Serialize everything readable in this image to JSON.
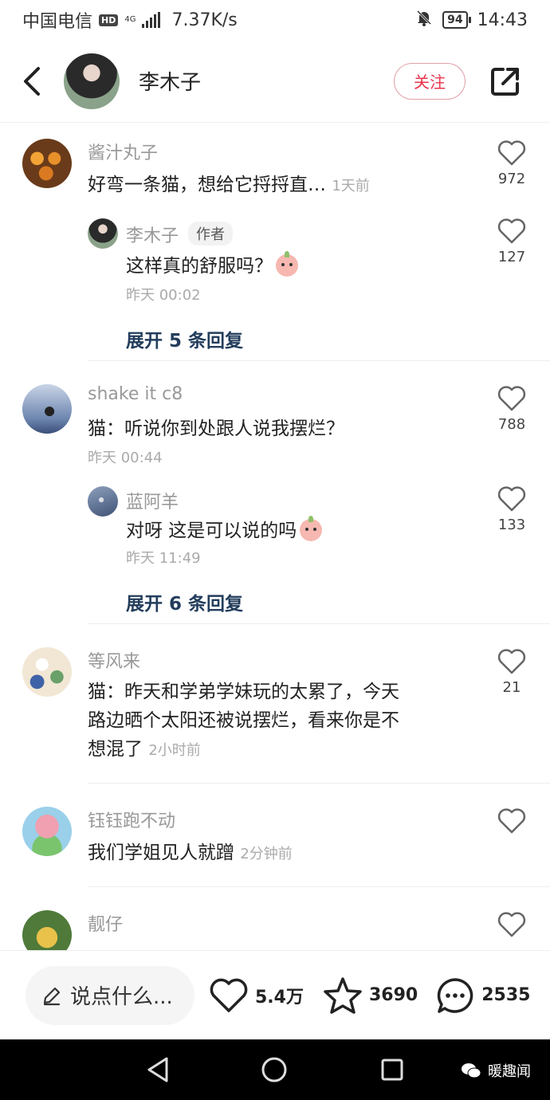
{
  "status_bar": {
    "carrier": "中国电信",
    "hd": "HD",
    "net_type": "4G",
    "speed": "7.37K/s",
    "battery": "94",
    "time": "14:43"
  },
  "header": {
    "title": "李木子",
    "follow_label": "关注"
  },
  "comments": [
    {
      "name": "酱汁丸子",
      "text": "好弯一条猫，想给它捋捋直…",
      "time": "1天前",
      "likes": "972",
      "reply": {
        "name": "李木子",
        "tag": "作者",
        "text": "这样真的舒服吗？",
        "time": "昨天 00:02",
        "likes": "127"
      },
      "expand": "展开 5 条回复"
    },
    {
      "name": "shake it c8",
      "text": "猫：听说你到处跟人说我摆烂？",
      "time": "昨天 00:44",
      "likes": "788",
      "reply": {
        "name": "蓝阿羊",
        "text": "对呀 这是可以说的吗",
        "time": "昨天 11:49",
        "likes": "133"
      },
      "expand": "展开 6 条回复"
    },
    {
      "name": "等风来",
      "lines": [
        "猫：昨天和学弟学妹玩的太累了，今天",
        "路边晒个太阳还被说摆烂，看来你是不",
        "想混了"
      ],
      "time": "2小时前",
      "likes": "21"
    },
    {
      "name": "钰钰跑不动",
      "text": "我们学姐见人就蹭",
      "time": "2分钟前"
    },
    {
      "name": "靓仔"
    }
  ],
  "bottom_bar": {
    "input_placeholder": "说点什么...",
    "likes": "5.4万",
    "stars": "3690",
    "comments": "2535"
  },
  "watermark": "暖趣闻"
}
